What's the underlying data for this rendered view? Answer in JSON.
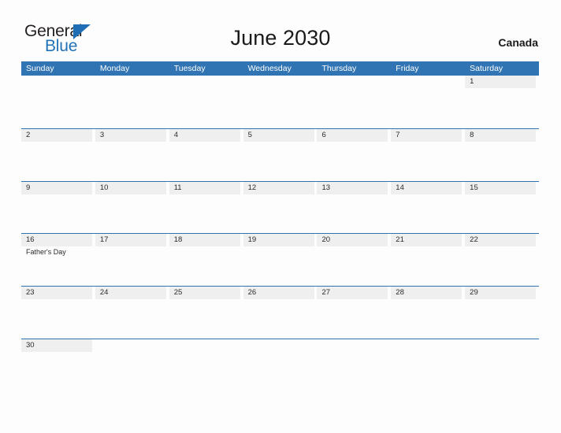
{
  "brand": {
    "word_one": "General",
    "word_two": "Blue",
    "triangle_icon": "triangle-icon",
    "accent_color": "#2272b8"
  },
  "header": {
    "title": "June 2030",
    "country": "Canada"
  },
  "theme": {
    "header_blue": "#3074b3",
    "row_divider_blue": "#2e72b0",
    "daynum_band_gray": "#efefef",
    "page_background": "#fdfdfd"
  },
  "calendar": {
    "month": "June",
    "year": "2030",
    "day_headers": [
      "Sunday",
      "Monday",
      "Tuesday",
      "Wednesday",
      "Thursday",
      "Friday",
      "Saturday"
    ],
    "weeks": [
      {
        "days": [
          {
            "num": "",
            "events": []
          },
          {
            "num": "",
            "events": []
          },
          {
            "num": "",
            "events": []
          },
          {
            "num": "",
            "events": []
          },
          {
            "num": "",
            "events": []
          },
          {
            "num": "",
            "events": []
          },
          {
            "num": "1",
            "events": []
          }
        ]
      },
      {
        "days": [
          {
            "num": "2",
            "events": []
          },
          {
            "num": "3",
            "events": []
          },
          {
            "num": "4",
            "events": []
          },
          {
            "num": "5",
            "events": []
          },
          {
            "num": "6",
            "events": []
          },
          {
            "num": "7",
            "events": []
          },
          {
            "num": "8",
            "events": []
          }
        ]
      },
      {
        "days": [
          {
            "num": "9",
            "events": []
          },
          {
            "num": "10",
            "events": []
          },
          {
            "num": "11",
            "events": []
          },
          {
            "num": "12",
            "events": []
          },
          {
            "num": "13",
            "events": []
          },
          {
            "num": "14",
            "events": []
          },
          {
            "num": "15",
            "events": []
          }
        ]
      },
      {
        "days": [
          {
            "num": "16",
            "events": [
              "Father's Day"
            ]
          },
          {
            "num": "17",
            "events": []
          },
          {
            "num": "18",
            "events": []
          },
          {
            "num": "19",
            "events": []
          },
          {
            "num": "20",
            "events": []
          },
          {
            "num": "21",
            "events": []
          },
          {
            "num": "22",
            "events": []
          }
        ]
      },
      {
        "days": [
          {
            "num": "23",
            "events": []
          },
          {
            "num": "24",
            "events": []
          },
          {
            "num": "25",
            "events": []
          },
          {
            "num": "26",
            "events": []
          },
          {
            "num": "27",
            "events": []
          },
          {
            "num": "28",
            "events": []
          },
          {
            "num": "29",
            "events": []
          }
        ]
      },
      {
        "days": [
          {
            "num": "30",
            "events": []
          },
          {
            "num": "",
            "events": []
          },
          {
            "num": "",
            "events": []
          },
          {
            "num": "",
            "events": []
          },
          {
            "num": "",
            "events": []
          },
          {
            "num": "",
            "events": []
          },
          {
            "num": "",
            "events": []
          }
        ]
      }
    ]
  }
}
